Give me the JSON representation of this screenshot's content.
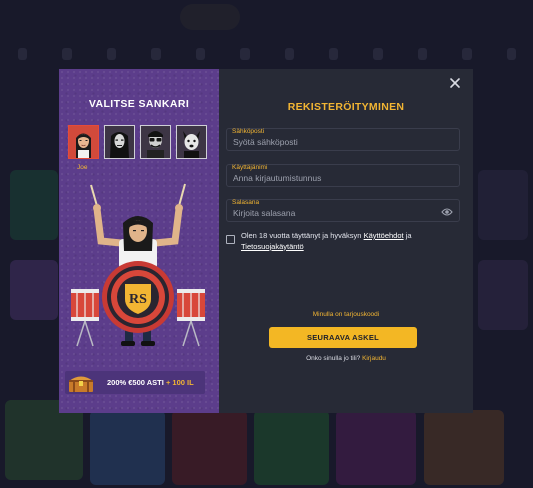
{
  "hero_panel": {
    "title": "VALITSE SANKARI",
    "selected_hero_name": "Joe",
    "avatars": [
      "joe",
      "hero-2",
      "hero-3",
      "hero-4"
    ],
    "drum_logo_text": "RS",
    "promo": {
      "main": "200% €500 ASTI",
      "extra": "+ 100 IL"
    }
  },
  "form": {
    "title": "REKISTERÖITYMINEN",
    "email": {
      "label": "Sähköposti",
      "placeholder": "Syötä sähköposti",
      "value": ""
    },
    "username": {
      "label": "Käyttäjänimi",
      "placeholder": "Anna kirjautumistunnus",
      "value": ""
    },
    "password": {
      "label": "Salasana",
      "placeholder": "Kirjoita salasana",
      "value": ""
    },
    "terms": {
      "prefix": "Olen 18 vuotta täyttänyt ja hyväksyn ",
      "link1": "Käyttöehdot",
      "middle": " ja ",
      "link2": "Tietosuojakäytäntö"
    },
    "promo_code_link": "Minulla on tarjouskoodi",
    "next_button": "SEURAAVA ASKEL",
    "login_prompt": "Onko sinulla jo tili?",
    "login_link": "Kirjaudu"
  },
  "colors": {
    "accent": "#f2b533",
    "button": "#f3b724",
    "panel": "#272a36",
    "hero_bg": "#5c3d8b",
    "selected_avatar": "#d24a3b"
  },
  "icons": [
    "close-icon",
    "eye-icon",
    "chest-icon"
  ]
}
